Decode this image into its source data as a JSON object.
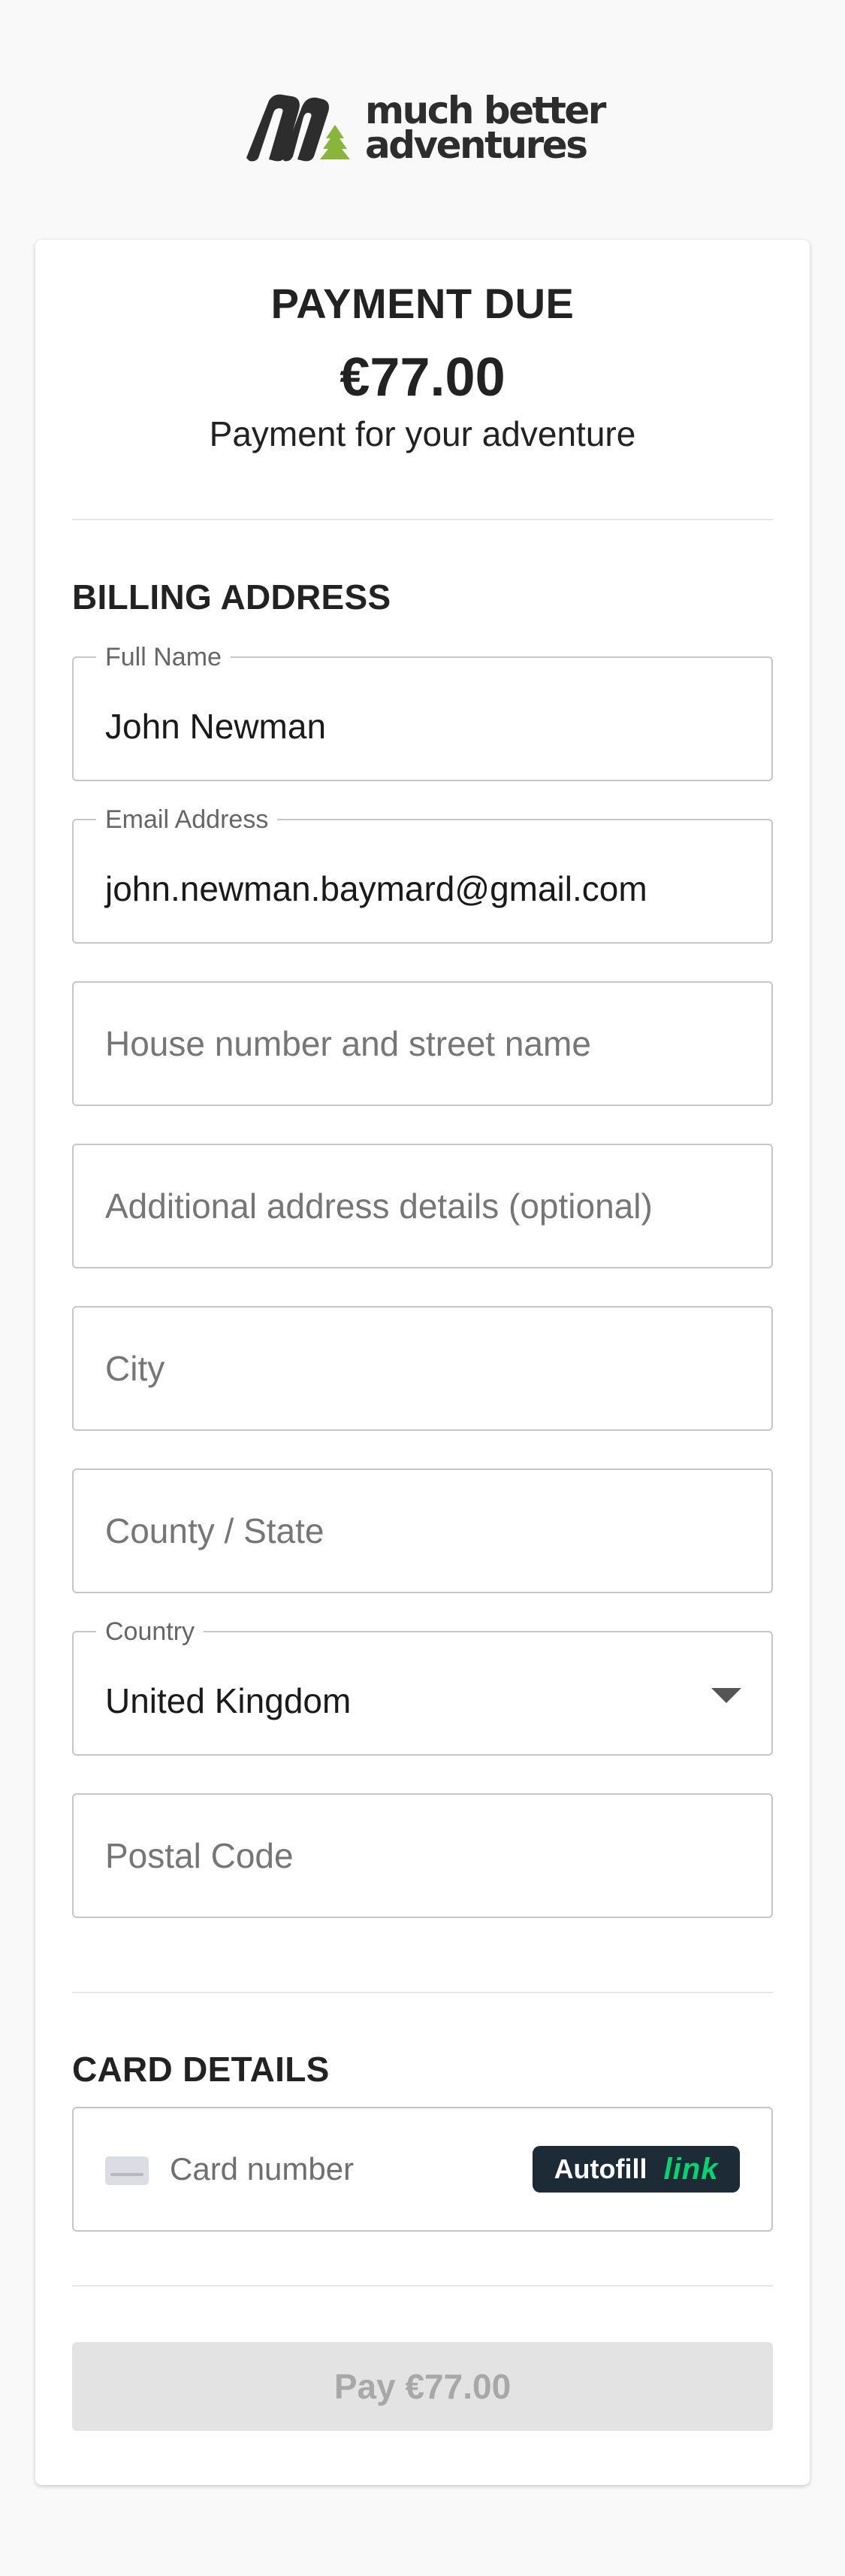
{
  "brand": {
    "logo_text": "much better adventures",
    "icon": "mba-logo-icon",
    "accent_color": "#8ab53b"
  },
  "payment": {
    "title": "PAYMENT DUE",
    "amount": "€77.00",
    "description": "Payment for your adventure"
  },
  "billing": {
    "section_title": "BILLING ADDRESS",
    "full_name": {
      "label": "Full Name",
      "value": "John Newman"
    },
    "email": {
      "label": "Email Address",
      "value": "john.newman.baymard@gmail.com"
    },
    "address_line1": {
      "placeholder": "House number and street name"
    },
    "address_line2": {
      "placeholder": "Additional address details (optional)"
    },
    "city": {
      "placeholder": "City"
    },
    "county": {
      "placeholder": "County / State"
    },
    "country": {
      "label": "Country",
      "value": "United Kingdom"
    },
    "postal_code": {
      "placeholder": "Postal Code"
    }
  },
  "card": {
    "section_title": "CARD DETAILS",
    "number_placeholder": "Card number",
    "card_icon": "credit-card-icon",
    "autofill_label": "Autofill",
    "link_label": "link",
    "link_color": "#00d66f"
  },
  "pay_button": {
    "label": "Pay €77.00"
  }
}
